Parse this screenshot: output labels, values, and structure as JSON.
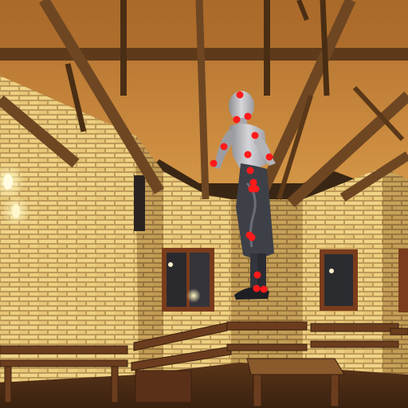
{
  "scene": {
    "colors": {
      "ceiling": "#c98a3e",
      "ceiling_dark": "#7a4a1c",
      "beam": "#6b4420",
      "beam_light": "#9a6a34",
      "brick_wall": "#d9b565",
      "brick_light": "#f2d98a",
      "mortar": "#8a6a3a",
      "bench": "#6a3e20",
      "floor": "#4a2a16",
      "window_frame": "#7a3a1c",
      "figure_body": "#b8b8bc",
      "figure_dark": "#3a3c44",
      "keypoint": "#ff1a1a"
    },
    "keypoint_count": 17
  }
}
